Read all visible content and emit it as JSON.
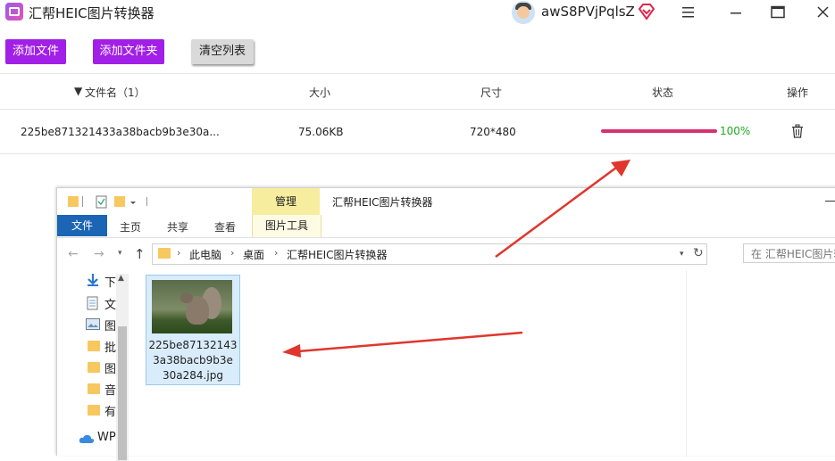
{
  "app": {
    "title": "汇帮HEIC图片转换器",
    "username": "awS8PVjPqlsZ"
  },
  "icons": {
    "app": "image-convert-icon",
    "vip": "diamond-icon",
    "menu": "hamburger-icon",
    "minimize": "minimize-icon",
    "maximize": "maximize-icon",
    "close": "close-icon",
    "delete": "trash-icon"
  },
  "colors": {
    "accent": "#a11fe6",
    "progress": "#d6336c",
    "progress_text": "#22a822",
    "file_tab": "#1c65b5",
    "manage_tab": "#f7ed9f",
    "arrow": "#e0362c"
  },
  "toolbar": {
    "add_file": "添加文件",
    "add_folder": "添加文件夹",
    "clear_list": "清空列表"
  },
  "table": {
    "headers": {
      "name": "文件名（1）",
      "size": "大小",
      "dimensions": "尺寸",
      "status": "状态",
      "action": "操作"
    },
    "rows": [
      {
        "name": "225be871321433a38bacb9b3e30a...",
        "size": "75.06KB",
        "dimensions": "720*480",
        "progress": 100,
        "progress_label": "100%"
      }
    ]
  },
  "explorer": {
    "manage_tab": "管理",
    "title": "汇帮HEIC图片转换器",
    "ribbon": {
      "file": "文件",
      "home": "主页",
      "share": "共享",
      "view": "查看",
      "picture_tools": "图片工具"
    },
    "breadcrumb": [
      "此电脑",
      "桌面",
      "汇帮HEIC图片转换器"
    ],
    "search_placeholder": "在 汇帮HEIC图片转",
    "nav_items": [
      "下",
      "文",
      "图",
      "批",
      "图",
      "音",
      "有",
      "WP"
    ],
    "file": {
      "name": "225be871321433a38bacb9b3e30a284.jpg",
      "name_lines": [
        "225be87132143",
        "3a38bacb9b3e",
        "30a284.jpg"
      ]
    }
  }
}
